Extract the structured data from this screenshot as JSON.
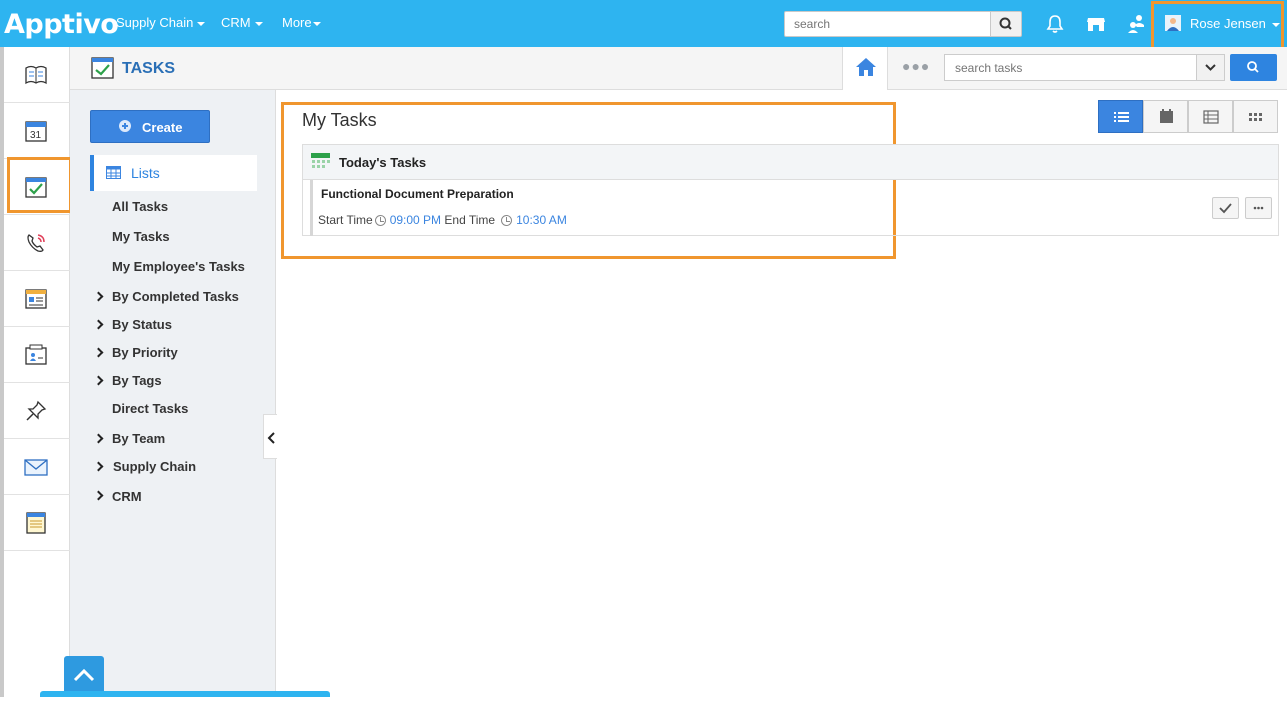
{
  "app": {
    "logo": "Apptivo"
  },
  "topnav": [
    {
      "label": "Supply Chain"
    },
    {
      "label": "CRM"
    },
    {
      "label": "More"
    }
  ],
  "global_search": {
    "placeholder": "search"
  },
  "user": {
    "name": "Rose Jensen"
  },
  "module": {
    "title": "TASKS"
  },
  "task_search": {
    "placeholder": "search tasks"
  },
  "sidebar": {
    "create_label": "Create",
    "lists_label": "Lists",
    "items": [
      {
        "label": "All Tasks"
      },
      {
        "label": "My Tasks"
      },
      {
        "label": "My Employee's Tasks"
      },
      {
        "label": "By Completed Tasks"
      },
      {
        "label": "By Status"
      },
      {
        "label": "By Priority"
      },
      {
        "label": "By Tags"
      },
      {
        "label": "Direct Tasks"
      },
      {
        "label": "By Team"
      },
      {
        "label": "Supply Chain"
      },
      {
        "label": "CRM"
      }
    ]
  },
  "main": {
    "title": "My Tasks",
    "section_title": "Today's Tasks",
    "task": {
      "name": "Functional Document Preparation",
      "start_label": "Start Time",
      "start_value": "09:00 PM",
      "end_label": "End Time",
      "end_value": "10:30 AM"
    }
  },
  "colors": {
    "topbar": "#2eb4f0",
    "accent": "#3b85e0",
    "highlight": "#f0962e"
  }
}
